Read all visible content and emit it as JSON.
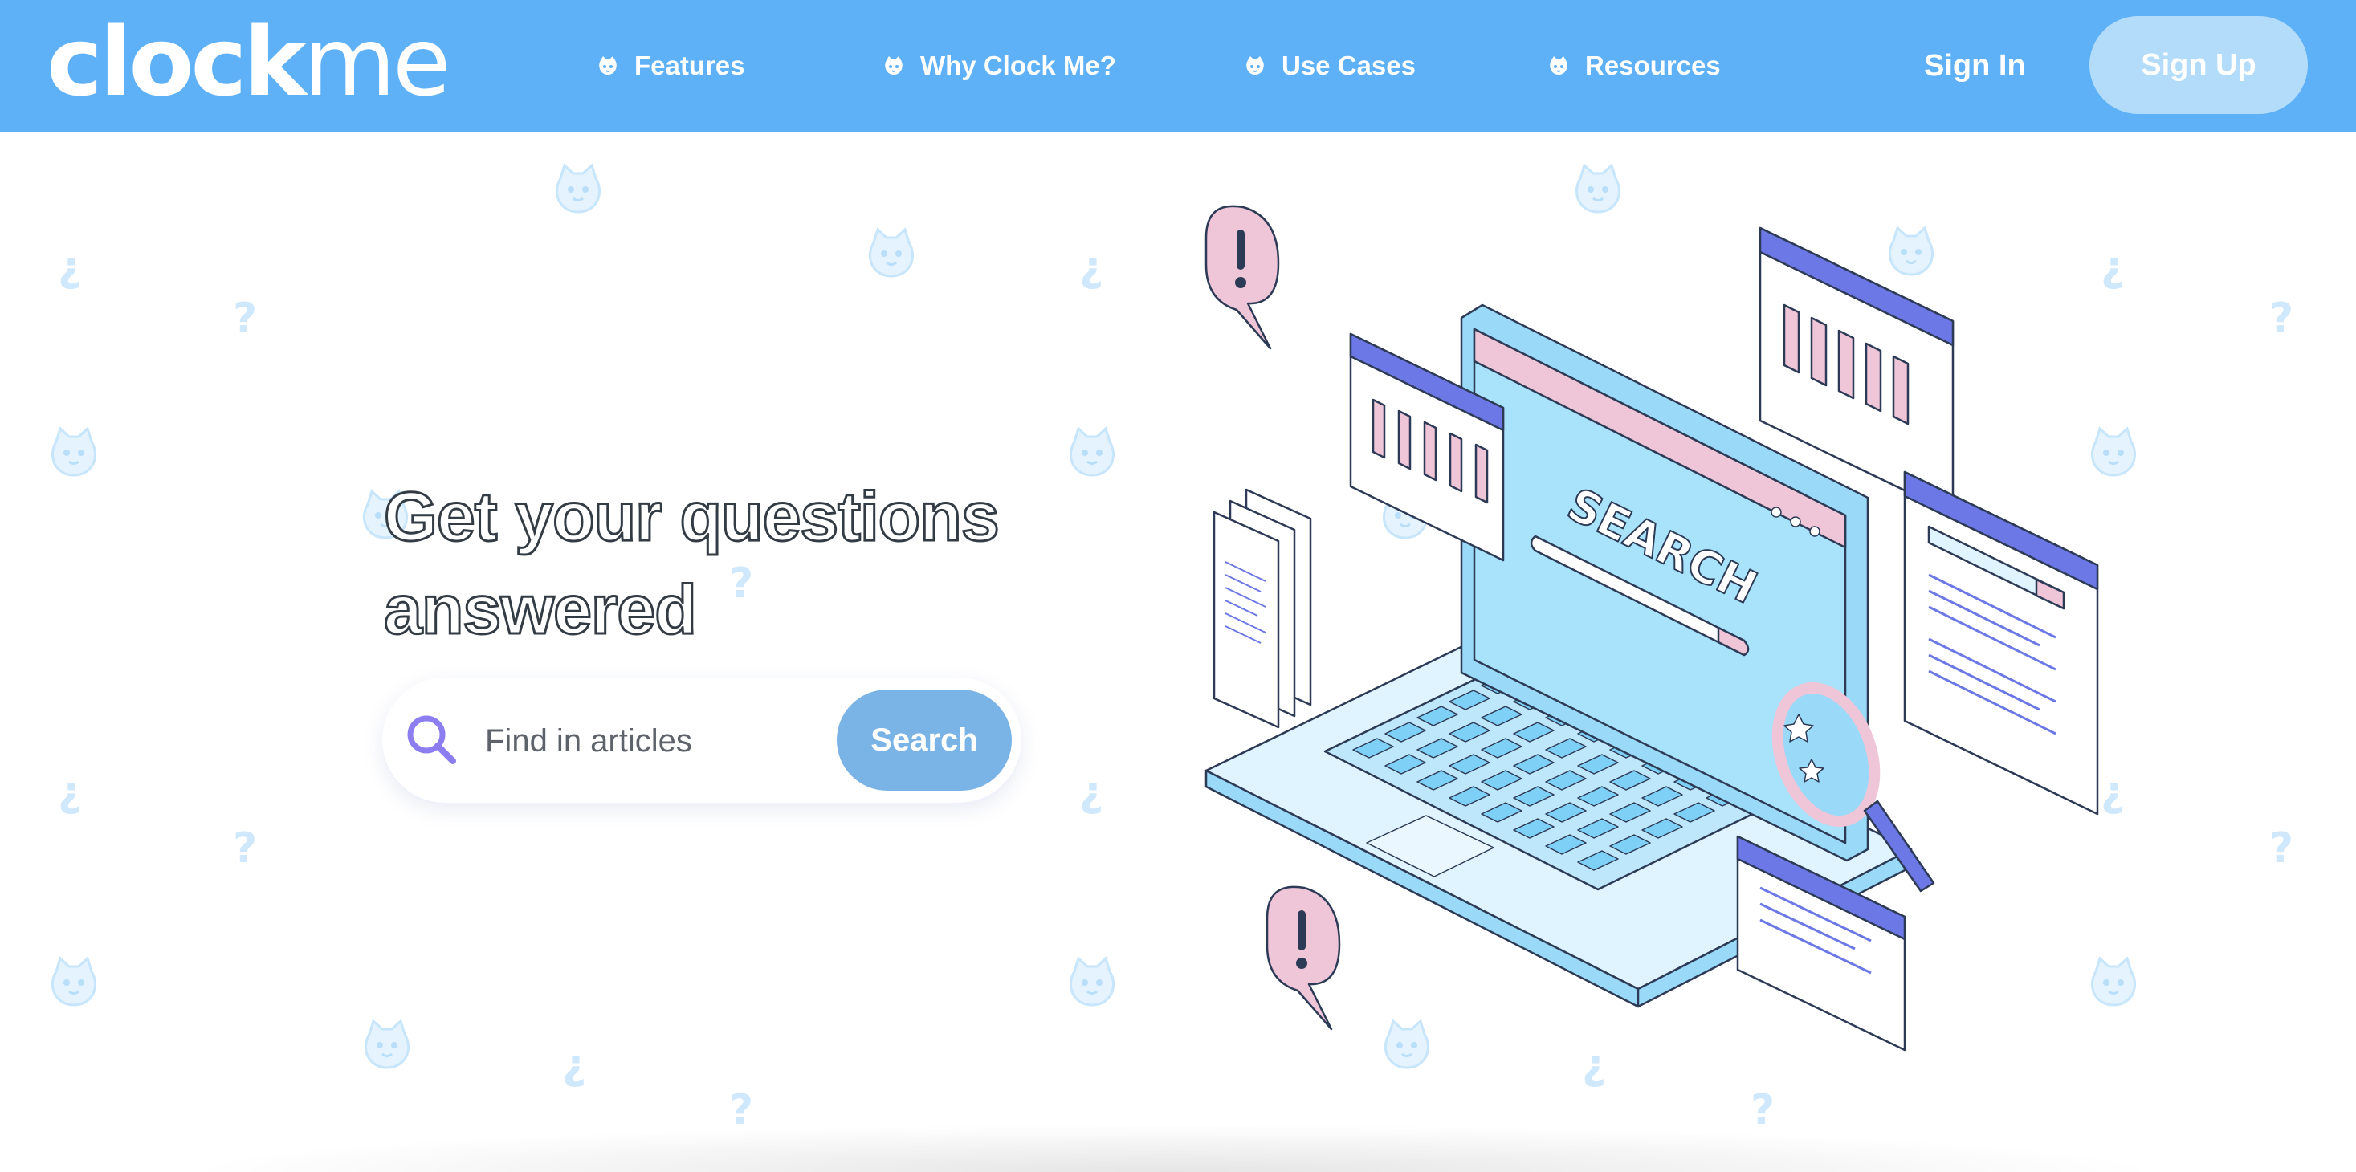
{
  "brand": {
    "logo_bold": "clock",
    "logo_light": "me"
  },
  "nav": {
    "items": [
      {
        "label": "Features",
        "icon": "cat-face-icon"
      },
      {
        "label": "Why Clock Me?",
        "icon": "cat-face-icon"
      },
      {
        "label": "Use Cases",
        "icon": "cat-face-icon"
      },
      {
        "label": "Resources",
        "icon": "cat-face-icon"
      }
    ],
    "sign_in": "Sign In",
    "sign_up": "Sign Up"
  },
  "hero": {
    "headline_line1": "Get your questions",
    "headline_line2": "answered",
    "search": {
      "placeholder": "Find in articles",
      "value": "",
      "button_label": "Search"
    }
  },
  "illustration": {
    "screen_text": "SEARCH"
  },
  "colors": {
    "header": "#5eb0f7",
    "signup_button": "#b3dcfb",
    "search_button": "#7ab3e6",
    "accent_purple": "#8c7ef0",
    "illustration_pink": "#efc5d8",
    "illustration_blue": "#9ad9f7",
    "illustration_indigo": "#6c78e6"
  }
}
